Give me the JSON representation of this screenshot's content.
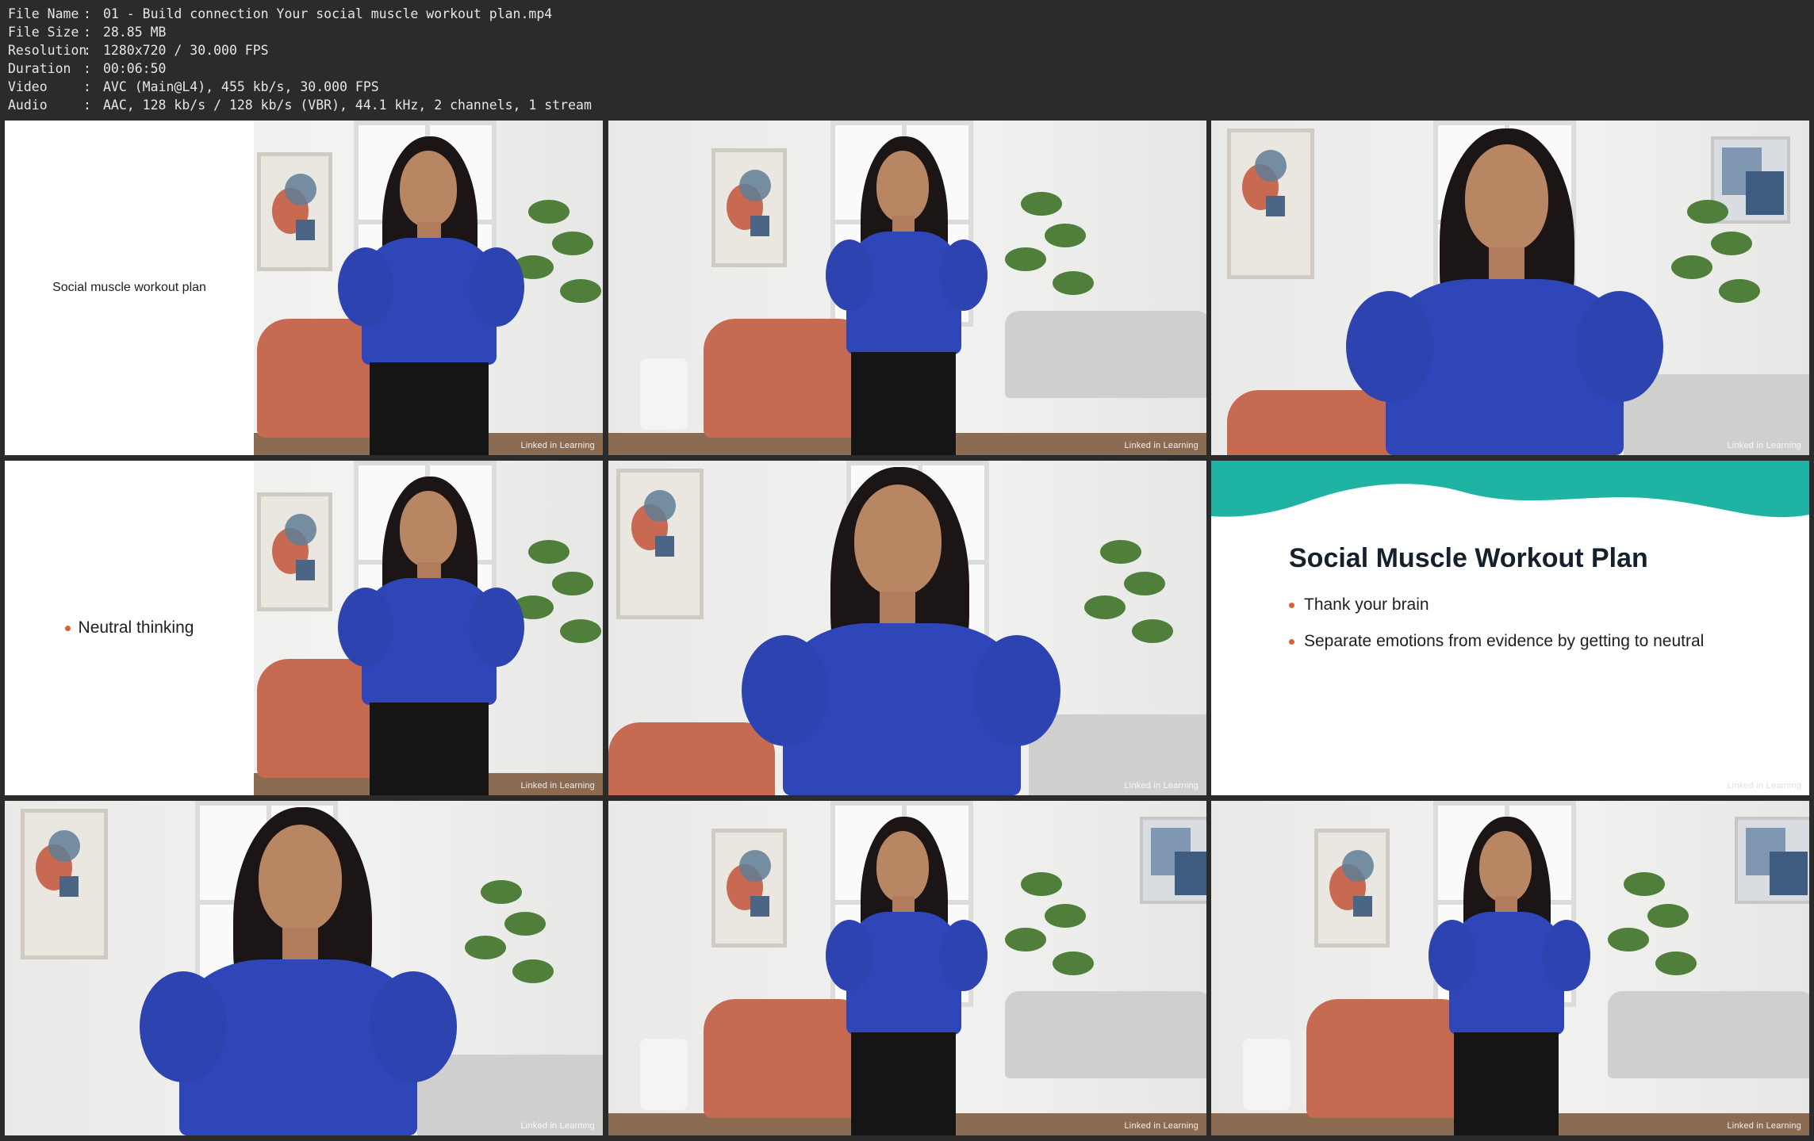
{
  "meta": {
    "rows": [
      {
        "key": "File Name",
        "sep": ":",
        "value": "01 - Build connection Your social muscle workout plan.mp4"
      },
      {
        "key": "File Size",
        "sep": ":",
        "value": "28.85 MB"
      },
      {
        "key": "Resolution",
        "sep": ":",
        "value": "1280x720 / 30.000 FPS"
      },
      {
        "key": "Duration",
        "sep": ":",
        "value": "00:06:50"
      },
      {
        "key": "Video",
        "sep": ":",
        "value": "AVC (Main@L4), 455 kb/s, 30.000 FPS"
      },
      {
        "key": "Audio",
        "sep": ":",
        "value": "AAC, 128 kb/s / 128 kb/s (VBR), 44.1 kHz, 2 channels, 1 stream"
      }
    ]
  },
  "watermark": "Linked in Learning",
  "frame1": {
    "slide_text": "Social muscle workout plan"
  },
  "frame4": {
    "bullet": "Neutral thinking"
  },
  "frame6": {
    "title": "Social Muscle Workout Plan",
    "bullets": [
      "Thank your brain",
      "Separate emotions from evidence by getting to neutral"
    ],
    "accent_color": "#1fb3a3",
    "bullet_color": "#d0643a"
  },
  "colors": {
    "background": "#2b2b2b",
    "meta_text": "#e6e6e6",
    "top": "#2f46b8"
  }
}
